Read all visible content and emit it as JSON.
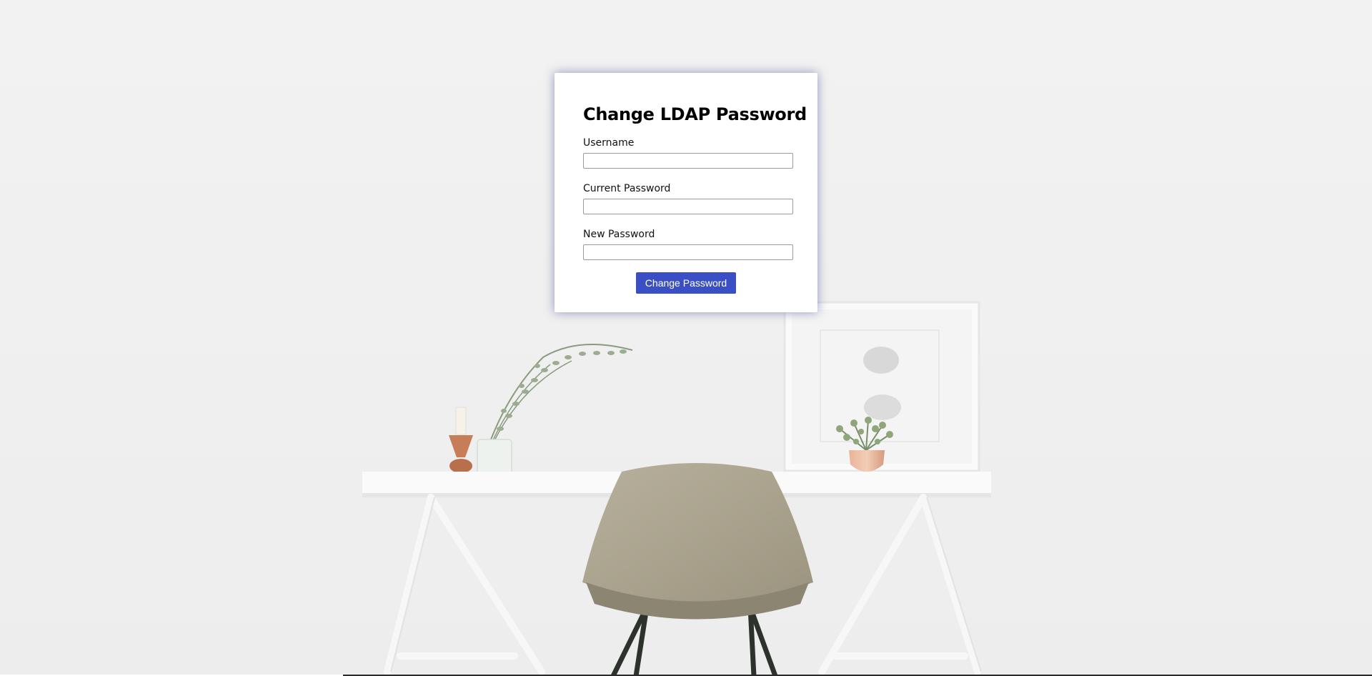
{
  "form": {
    "title": "Change LDAP Password",
    "fields": [
      {
        "label": "Username",
        "value": "",
        "placeholder": ""
      },
      {
        "label": "Current Password",
        "value": "",
        "placeholder": ""
      },
      {
        "label": "New Password",
        "value": "",
        "placeholder": ""
      }
    ],
    "submit_label": "Change Password"
  },
  "colors": {
    "button": "#3a4fc4",
    "card_shadow": "#3c4696",
    "background": "#f1f1f1"
  }
}
